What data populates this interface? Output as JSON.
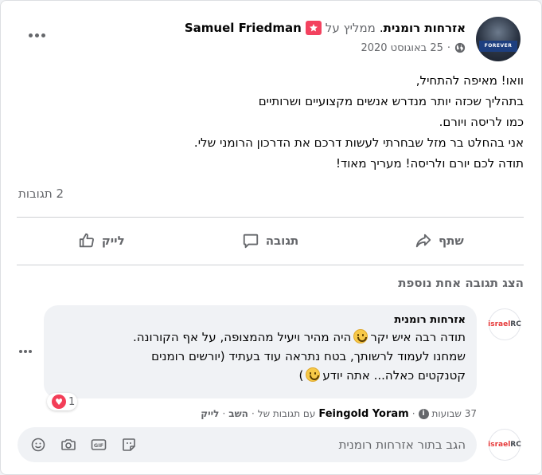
{
  "post": {
    "author_name": "Samuel Friedman",
    "action_text": "ממליץ על",
    "page_name": "אזרחות רומנית",
    "page_name_suffix": ".",
    "date": "25 באוגוסט 2020",
    "date_separator": "·",
    "avatar_band_text": "FOREVER",
    "body_lines": [
      "וואו! מאיפה להתחיל,",
      "בתהליך שכזה יותר מנדרש אנשים מקצועיים ושרותיים",
      "כמו לריסה ויורם.",
      "אני בהחלט בר מזל שבחרתי לעשות דרכם את הדרכון הרומני שלי.",
      "תודה לכם יורם ולריסה! מעריך מאוד!"
    ],
    "reply_count": "2 תגובות"
  },
  "actions": {
    "like": "לייק",
    "comment": "תגובה",
    "share": "שתף"
  },
  "more_replies_label": "הצג תגובה אחת נוספת",
  "comment": {
    "avatar_text_prefix": "RC",
    "avatar_text_suffix": "israel",
    "author": "אזרחות רומנית",
    "line1_before": "תודה רבה איש יקר",
    "line1_after": "היה מהיר ויעיל מהמצופה, על אף הקורונה.",
    "line2": "שמחנו לעמוד לרשותך, בטח נתראה עוד בעתיד (יורשים רומנים",
    "line3_before": "קטנקטים כאלה... אתה יודע",
    "line3_after": ")",
    "reaction_count": "1",
    "like": "לייק",
    "reply": "השב",
    "reply_to_prefix": "עם תגובות של",
    "reply_to_name": "Feingold Yoram",
    "age": "37 שבועות",
    "separator": "·"
  },
  "reply_box": {
    "placeholder": "הגב בתור אזרחות רומנית"
  },
  "colors": {
    "text": "#050505",
    "secondary": "#65676b",
    "bubble": "#f0f2f5",
    "recommend": "#f3425f",
    "love": "#f33e58"
  }
}
